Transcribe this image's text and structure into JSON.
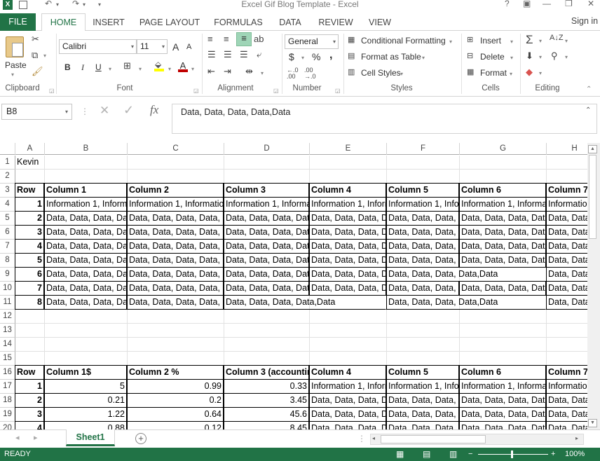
{
  "window": {
    "title": "Excel Gif Blog Template - Excel",
    "help": "?",
    "minimize": "—",
    "restore": "❐",
    "close": "✕",
    "signin": "Sign in"
  },
  "tabs": {
    "file": "FILE",
    "home": "HOME",
    "insert": "INSERT",
    "page_layout": "PAGE LAYOUT",
    "formulas": "FORMULAS",
    "data": "DATA",
    "review": "REVIEW",
    "view": "VIEW"
  },
  "ribbon": {
    "clipboard": {
      "label": "Clipboard",
      "paste": "Paste"
    },
    "font": {
      "label": "Font",
      "name": "Calibri",
      "size": "11",
      "bold": "B",
      "italic": "I",
      "underline": "U",
      "grow": "A",
      "shrink": "A"
    },
    "alignment": {
      "label": "Alignment"
    },
    "number": {
      "label": "Number",
      "format": "General",
      "currency": "$",
      "percent": "%",
      "comma": ","
    },
    "styles": {
      "label": "Styles",
      "conditional": "Conditional Formatting",
      "table": "Format as Table",
      "cellstyles": "Cell Styles"
    },
    "cells": {
      "label": "Cells",
      "insert": "Insert",
      "delete": "Delete",
      "format": "Format"
    },
    "editing": {
      "label": "Editing"
    }
  },
  "formula_bar": {
    "name_box": "B8",
    "content": "Data, Data, Data, Data,Data",
    "fx": "fx",
    "cancel": "✕",
    "enter": "✓"
  },
  "grid": {
    "columns": [
      "A",
      "B",
      "C",
      "D",
      "E",
      "F",
      "G",
      "H"
    ],
    "rows": [
      "1",
      "2",
      "3",
      "4",
      "5",
      "6",
      "7",
      "8",
      "9",
      "10",
      "11",
      "12",
      "13",
      "14",
      "15",
      "16",
      "17",
      "18",
      "19",
      "20"
    ],
    "r1": {
      "a": "Kevin"
    },
    "r3": [
      "Row",
      "Column 1",
      "Column 2",
      "Column 3",
      "Column 4",
      "Column 5",
      "Column 6",
      "Column 7"
    ],
    "info": "Information 1, Information 1, Information 1",
    "data": "Data, Data, Data, Data, Data",
    "data_short": "Data, Data, Data, Data,Data",
    "nums": [
      "1",
      "2",
      "3",
      "4",
      "5",
      "6",
      "7",
      "8"
    ],
    "r16": [
      "Row",
      "Column 1$",
      "Column 2 %",
      "Column 3 (accounting)",
      "Column 4",
      "Column 5",
      "Column 6",
      "Column 7"
    ],
    "r17": [
      "1",
      "5",
      "0.99",
      "0.33"
    ],
    "r18": [
      "2",
      "0.21",
      "0.2",
      "3.45"
    ],
    "r19": [
      "3",
      "1.22",
      "0.64",
      "45.6"
    ],
    "r20": [
      "4",
      "0.88",
      "0.12",
      "8.45"
    ]
  },
  "sheet": {
    "tab": "Sheet1",
    "add": "+"
  },
  "status": {
    "ready": "READY",
    "zoom": "100%"
  },
  "colors": {
    "accent": "#217346"
  }
}
